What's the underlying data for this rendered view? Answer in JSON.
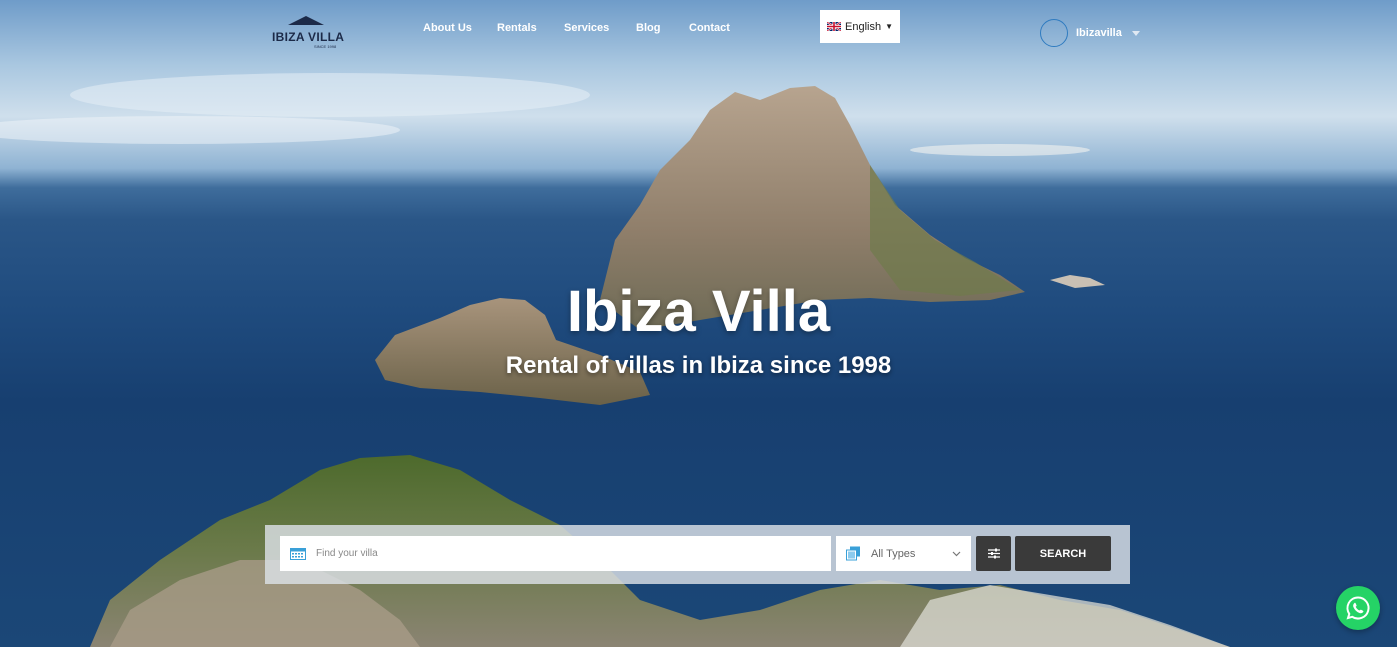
{
  "brand": {
    "logo_text": "IBIZA VILLA",
    "logo_sub": "SINCE 1998"
  },
  "nav": {
    "items": [
      "About Us",
      "Rentals",
      "Services",
      "Blog",
      "Contact"
    ]
  },
  "language": {
    "selected": "English"
  },
  "user": {
    "name": "Ibizavilla"
  },
  "hero": {
    "title": "Ibiza Villa",
    "subtitle": "Rental of villas in Ibiza since 1998"
  },
  "search": {
    "placeholder": "Find your villa",
    "type_value": "All Types",
    "submit_label": "SEARCH"
  },
  "icons": {
    "calendar": "calendar-icon",
    "types": "copy-icon",
    "filters": "sliders-icon",
    "whatsapp": "whatsapp-icon"
  },
  "colors": {
    "button": "#3a3a3a",
    "whatsapp": "#25d366",
    "logo": "#1c2a48"
  }
}
